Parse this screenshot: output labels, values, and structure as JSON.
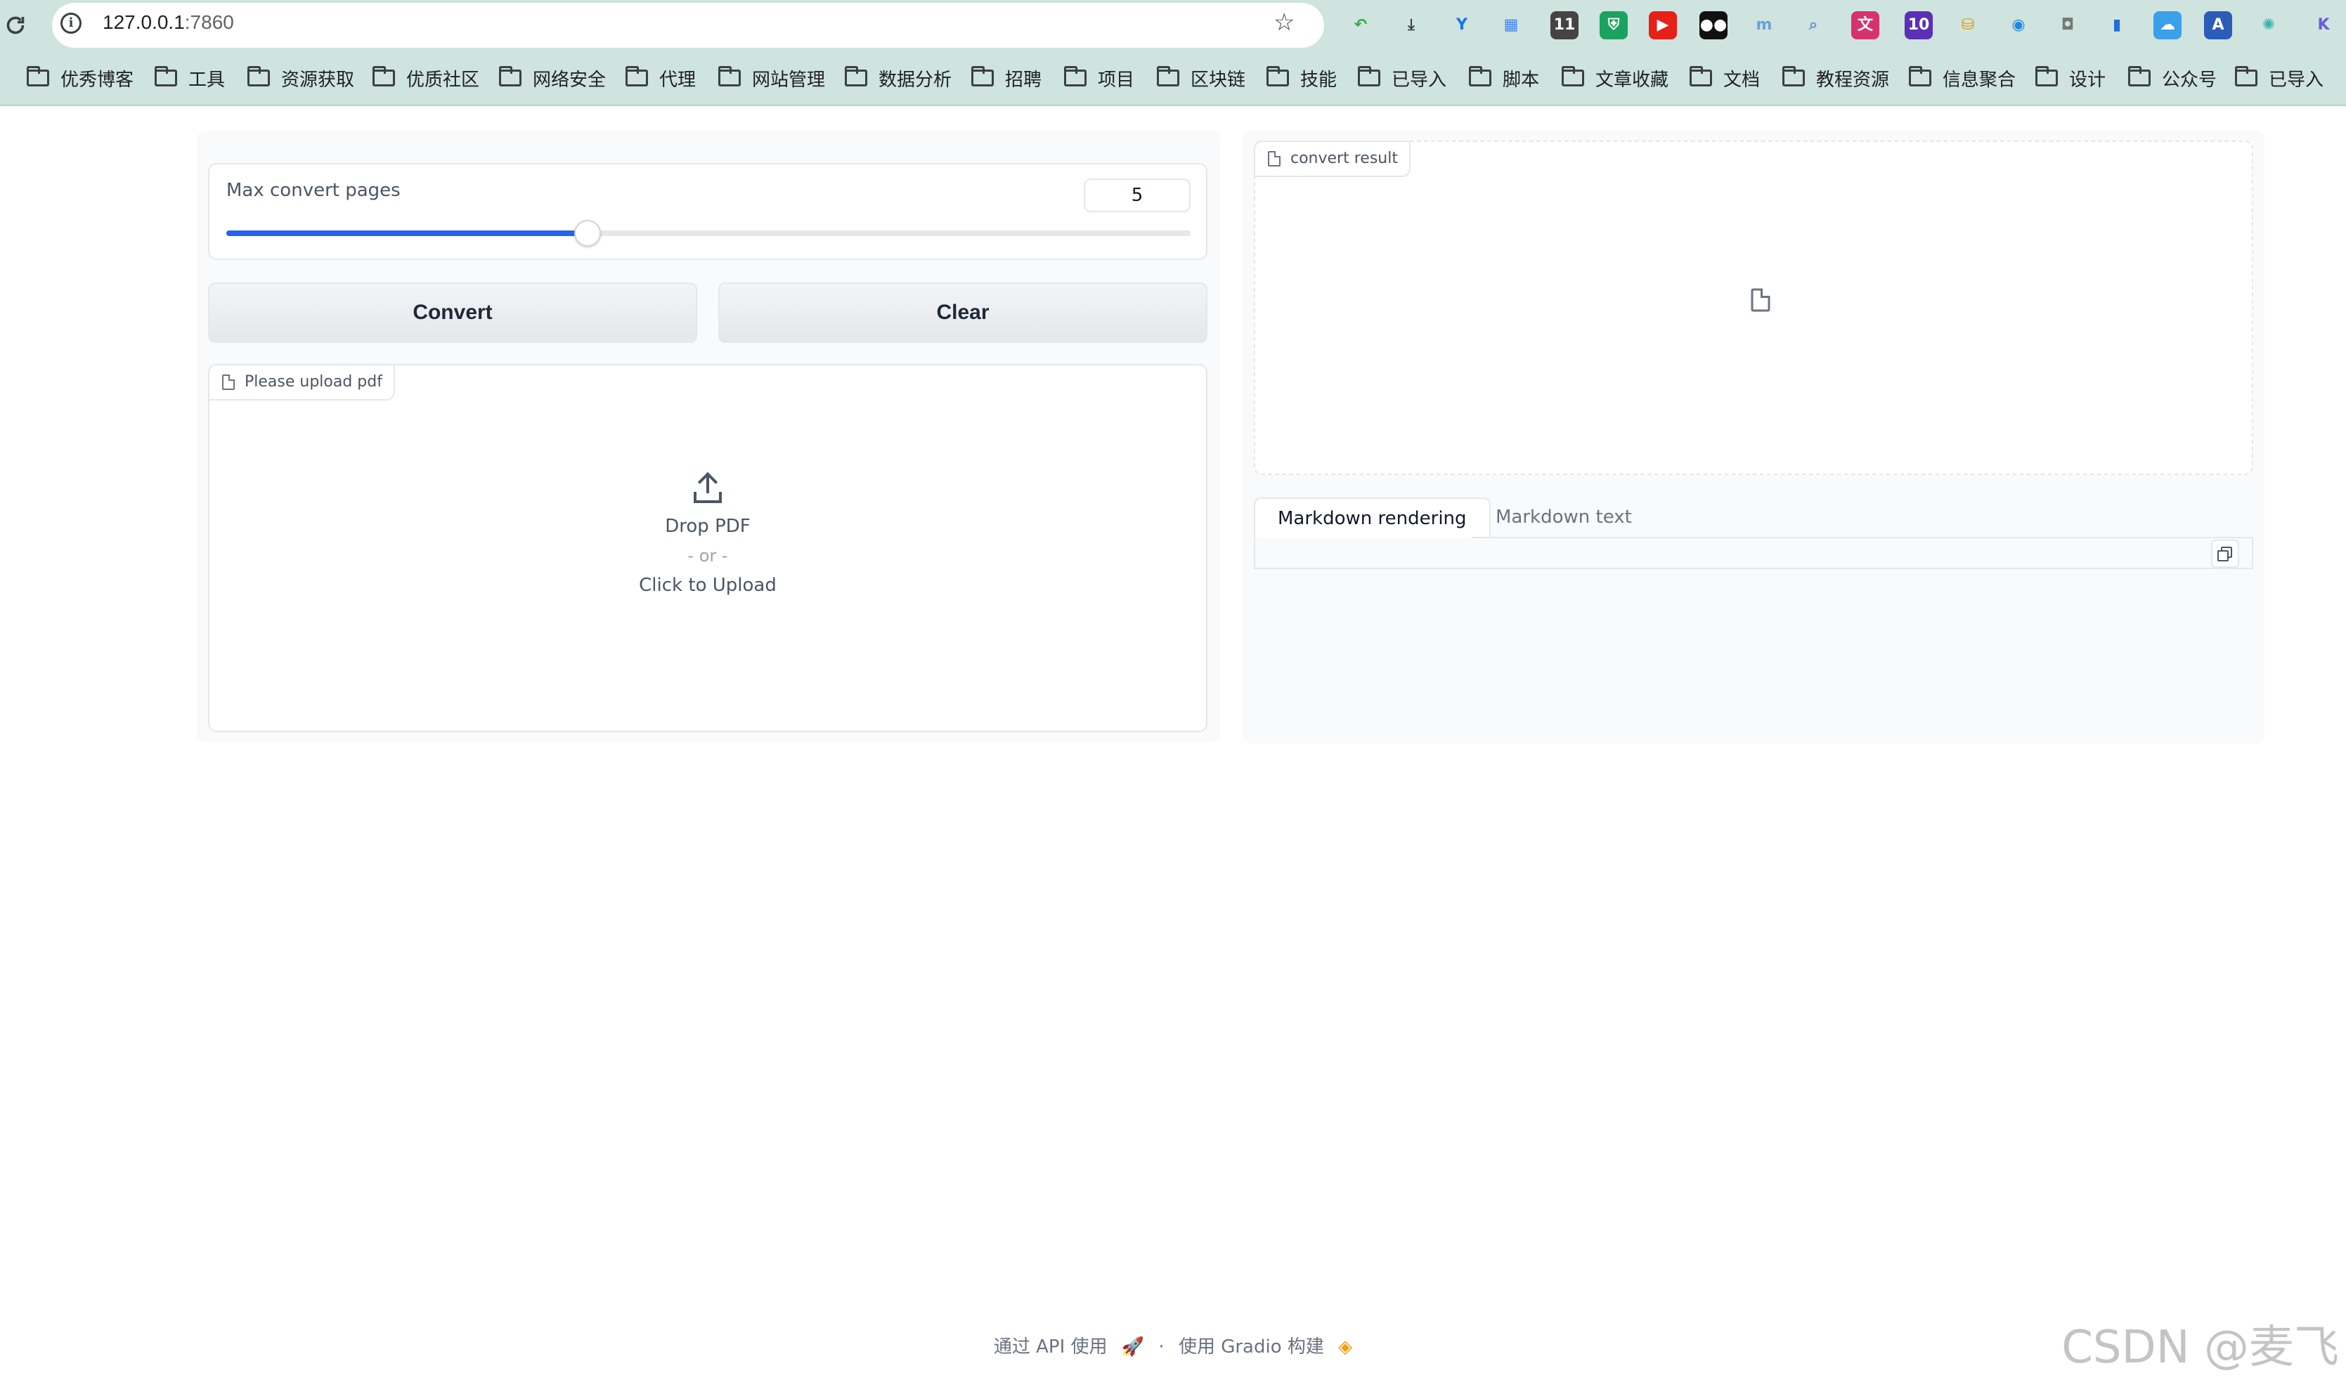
{
  "browser": {
    "url_host": "127.0.0.1",
    "url_port": ":7860",
    "bookmarks": [
      "优秀博客",
      "工具",
      "资源获取",
      "优质社区",
      "网络安全",
      "代理",
      "网站管理",
      "数据分析",
      "招聘",
      "项目",
      "区块链",
      "技能",
      "已导入",
      "脚本",
      "文章收藏",
      "文档",
      "教程资源",
      "信息聚合",
      "设计",
      "公众号",
      "已导入"
    ],
    "extensions": [
      {
        "name": "back-arrow-ext-icon",
        "glyph": "↶",
        "bg": "#cfe3df",
        "fg": "#3aa845"
      },
      {
        "name": "download-icon",
        "glyph": "⤓",
        "bg": "#cfe3df",
        "fg": "#3c4043"
      },
      {
        "name": "y-ext-icon",
        "glyph": "Y",
        "bg": "#cfe3df",
        "fg": "#1a73e8"
      },
      {
        "name": "grid-ext-icon",
        "glyph": "▦",
        "bg": "#cfe3df",
        "fg": "#4285f4"
      },
      {
        "name": "calendar-ext-icon",
        "glyph": "11",
        "bg": "#444",
        "fg": "#fff"
      },
      {
        "name": "shield-ext-icon",
        "glyph": "⛨",
        "bg": "#1aa260",
        "fg": "#fff"
      },
      {
        "name": "youtube-ext-icon",
        "glyph": "▶",
        "bg": "#e62117",
        "fg": "#fff"
      },
      {
        "name": "glasses-ext-icon",
        "glyph": "●●",
        "bg": "#111",
        "fg": "#fff"
      },
      {
        "name": "mu-ext-icon",
        "glyph": "m",
        "bg": "#cfe3df",
        "fg": "#6aa3d9"
      },
      {
        "name": "magnifier-ext-icon",
        "glyph": "⌕",
        "bg": "#cfe3df",
        "fg": "#6a8fd8"
      },
      {
        "name": "translate-ext-icon",
        "glyph": "文",
        "bg": "#d6336c",
        "fg": "#fff"
      },
      {
        "name": "graduate-ext-icon",
        "glyph": "10",
        "bg": "#5b2fb6",
        "fg": "#fff"
      },
      {
        "name": "folder-yellow-ext-icon",
        "glyph": "⛁",
        "bg": "#cfe3df",
        "fg": "#d59b00"
      },
      {
        "name": "chrome-like-ext-icon",
        "glyph": "◉",
        "bg": "#cfe3df",
        "fg": "#1e88e5"
      },
      {
        "name": "camera-ext-icon",
        "glyph": "◘",
        "bg": "#cfe3df",
        "fg": "#777"
      },
      {
        "name": "bookmark-ext-icon",
        "glyph": "▮",
        "bg": "#cfe3df",
        "fg": "#1e6fd9"
      },
      {
        "name": "cloud-ext-icon",
        "glyph": "☁",
        "bg": "#3aa0e8",
        "fg": "#fff"
      },
      {
        "name": "a-ext-icon",
        "glyph": "A",
        "bg": "#2a5cb8",
        "fg": "#fff"
      },
      {
        "name": "globe-ext-icon",
        "glyph": "✺",
        "bg": "#cfe3df",
        "fg": "#3fb5a8"
      },
      {
        "name": "k-ext-icon",
        "glyph": "K",
        "bg": "#cfe3df",
        "fg": "#6b5cd6"
      }
    ]
  },
  "left": {
    "slider": {
      "label": "Max convert pages",
      "value": 5,
      "min": 1,
      "max": 11
    },
    "buttons": {
      "convert": "Convert",
      "clear": "Clear"
    },
    "upload": {
      "chip": "Please upload pdf",
      "drop": "Drop PDF",
      "or": "- or -",
      "click": "Click to Upload"
    }
  },
  "right": {
    "result_chip": "convert result",
    "tabs": [
      "Markdown rendering",
      "Markdown text"
    ]
  },
  "footer": {
    "api": "通过 API 使用",
    "sep": "·",
    "built": "使用 Gradio 构建"
  },
  "watermark": "CSDN @麦飞",
  "colors": {
    "accent": "#2563eb"
  }
}
